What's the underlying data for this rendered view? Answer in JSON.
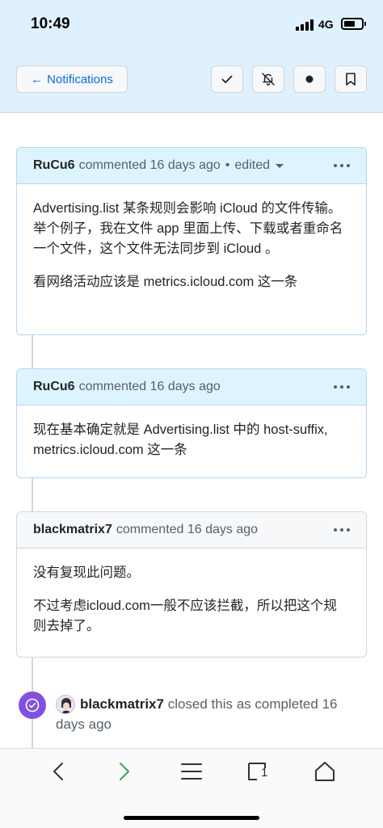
{
  "status_bar": {
    "time": "10:49",
    "network": "4G"
  },
  "header": {
    "notifications_label": "Notifications",
    "icons": {
      "back": "arrow-left",
      "done": "check-icon",
      "unsubscribe": "bell-slash-icon",
      "unread": "dot-icon",
      "save": "bookmark-icon"
    }
  },
  "comments": [
    {
      "author": "RuCu6",
      "meta": "commented 16 days ago",
      "edited": "edited",
      "paragraphs": [
        "Advertising.list 某条规则会影响 iCloud 的文件传输。",
        "举个例子，我在文件 app 里面上传、下载或者重命名一个文件，这个文件无法同步到 iCloud 。",
        "看网络活动应该是 metrics.icloud.com 这一条"
      ]
    },
    {
      "author": "RuCu6",
      "meta": "commented 16 days ago",
      "paragraphs": [
        "现在基本确定就是 Advertising.list 中的 host-suffix, metrics.icloud.com 这一条"
      ]
    },
    {
      "author": "blackmatrix7",
      "meta": "commented 16 days ago",
      "paragraphs": [
        "没有复现此问题。",
        "不过考虑icloud.com一般不应该拦截，所以把这个规则去掉了。"
      ]
    }
  ],
  "event": {
    "author": "blackmatrix7",
    "text": "closed this as completed 16 days ago",
    "icon": "check-circle-icon"
  },
  "bottom_bar": {
    "icons": [
      "chevron-left-icon",
      "chevron-right-icon",
      "menu-icon",
      "tabs-icon",
      "home-icon"
    ],
    "tabs_count": "1"
  },
  "colors": {
    "accent": "#0969da",
    "header_bg": "#dff0ff",
    "closed_purple": "#8250df",
    "forward_green": "#34a853"
  }
}
